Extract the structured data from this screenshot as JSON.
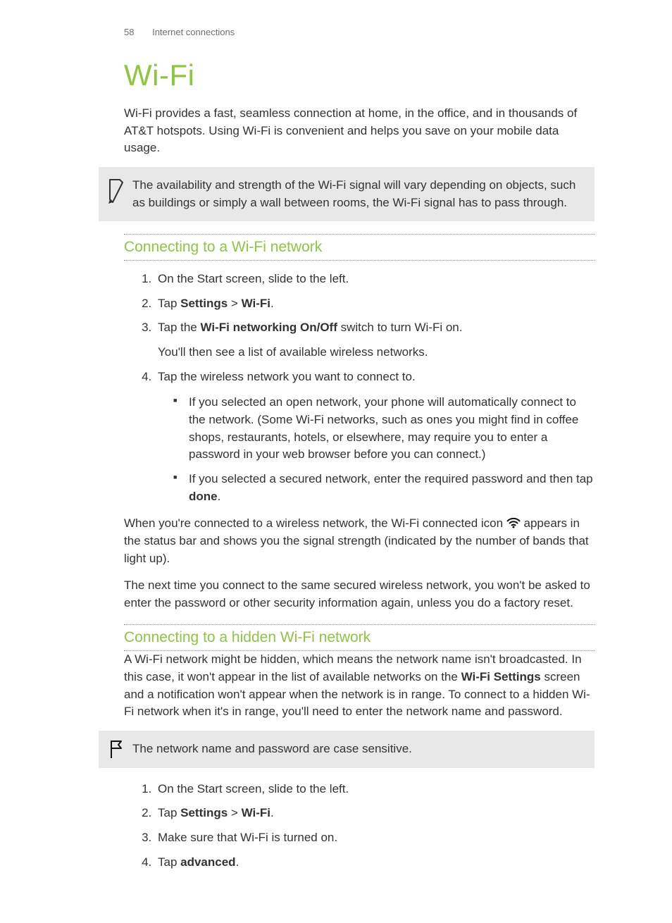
{
  "header": {
    "page_number": "58",
    "chapter": "Internet connections"
  },
  "title": "Wi-Fi",
  "intro": "Wi-Fi provides a fast, seamless connection at home, in the office, and in thousands of AT&T hotspots. Using Wi-Fi is convenient and helps you save on your mobile data usage.",
  "note1": "The availability and strength of the Wi-Fi signal will vary depending on objects, such as buildings or simply a wall between rooms, the Wi-Fi signal has to pass through.",
  "section1": {
    "heading": "Connecting to a Wi-Fi network",
    "steps": {
      "s1": "On the Start screen, slide to the left.",
      "s2_a": "Tap ",
      "s2_b": "Settings",
      "s2_c": " > ",
      "s2_d": "Wi-Fi",
      "s2_e": ".",
      "s3_a": "Tap the ",
      "s3_b": "Wi-Fi networking On/Off",
      "s3_c": " switch to turn Wi-Fi on.",
      "s3_note": "You'll then see a list of available wireless networks.",
      "s4": "Tap the wireless network you want to connect to.",
      "s4_b1": "If you selected an open network, your phone will automatically connect to the network. (Some Wi-Fi networks, such as ones you might find in coffee shops, restaurants, hotels, or elsewhere, may require you to enter a password in your web browser before you can connect.)",
      "s4_b2_a": "If you selected a secured network, enter the required password and then tap ",
      "s4_b2_b": "done",
      "s4_b2_c": "."
    },
    "after1_a": "When you're connected to a wireless network, the Wi-Fi connected icon ",
    "after1_b": " appears in the status bar and shows you the signal strength (indicated by the number of bands that light up).",
    "after2": "The next time you connect to the same secured wireless network, you won't be asked to enter the password or other security information again, unless you do a factory reset."
  },
  "section2": {
    "heading": "Connecting to a hidden Wi-Fi network",
    "intro_a": "A Wi-Fi network might be hidden, which means the network name isn't broadcasted. In this case, it won't appear in the list of available networks on the ",
    "intro_b": "Wi-Fi Settings",
    "intro_c": " screen and a notification won't appear when the network is in range. To connect to a hidden Wi-Fi network when it's in range, you'll need to enter the network name and password.",
    "flag_note": "The network name and password are case sensitive.",
    "steps": {
      "s1": "On the Start screen, slide to the left.",
      "s2_a": "Tap ",
      "s2_b": "Settings",
      "s2_c": " > ",
      "s2_d": "Wi-Fi",
      "s2_e": ".",
      "s3": "Make sure that Wi-Fi is turned on.",
      "s4_a": "Tap ",
      "s4_b": "advanced",
      "s4_c": "."
    }
  }
}
